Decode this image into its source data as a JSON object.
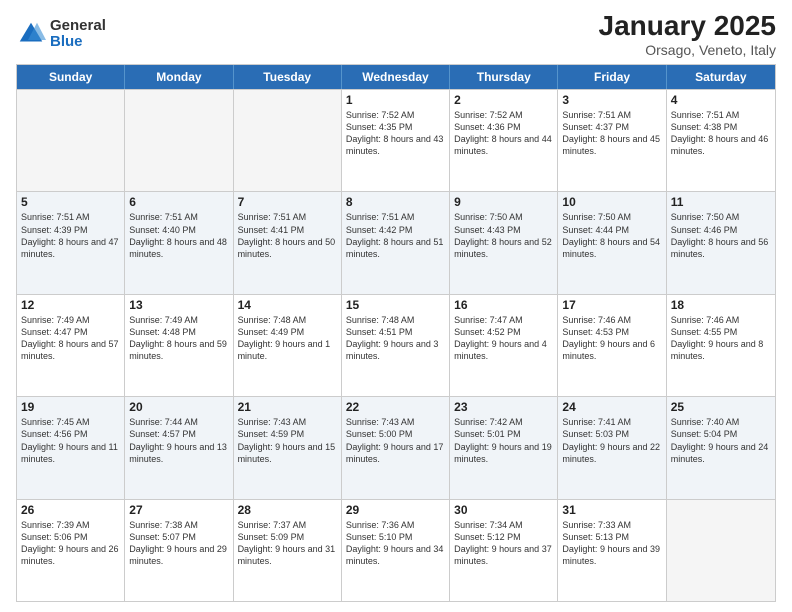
{
  "header": {
    "logo_general": "General",
    "logo_blue": "Blue",
    "main_title": "January 2025",
    "subtitle": "Orsago, Veneto, Italy"
  },
  "days_of_week": [
    "Sunday",
    "Monday",
    "Tuesday",
    "Wednesday",
    "Thursday",
    "Friday",
    "Saturday"
  ],
  "weeks": [
    [
      {
        "day": "",
        "text": ""
      },
      {
        "day": "",
        "text": ""
      },
      {
        "day": "",
        "text": ""
      },
      {
        "day": "1",
        "text": "Sunrise: 7:52 AM\nSunset: 4:35 PM\nDaylight: 8 hours\nand 43 minutes."
      },
      {
        "day": "2",
        "text": "Sunrise: 7:52 AM\nSunset: 4:36 PM\nDaylight: 8 hours\nand 44 minutes."
      },
      {
        "day": "3",
        "text": "Sunrise: 7:51 AM\nSunset: 4:37 PM\nDaylight: 8 hours\nand 45 minutes."
      },
      {
        "day": "4",
        "text": "Sunrise: 7:51 AM\nSunset: 4:38 PM\nDaylight: 8 hours\nand 46 minutes."
      }
    ],
    [
      {
        "day": "5",
        "text": "Sunrise: 7:51 AM\nSunset: 4:39 PM\nDaylight: 8 hours\nand 47 minutes."
      },
      {
        "day": "6",
        "text": "Sunrise: 7:51 AM\nSunset: 4:40 PM\nDaylight: 8 hours\nand 48 minutes."
      },
      {
        "day": "7",
        "text": "Sunrise: 7:51 AM\nSunset: 4:41 PM\nDaylight: 8 hours\nand 50 minutes."
      },
      {
        "day": "8",
        "text": "Sunrise: 7:51 AM\nSunset: 4:42 PM\nDaylight: 8 hours\nand 51 minutes."
      },
      {
        "day": "9",
        "text": "Sunrise: 7:50 AM\nSunset: 4:43 PM\nDaylight: 8 hours\nand 52 minutes."
      },
      {
        "day": "10",
        "text": "Sunrise: 7:50 AM\nSunset: 4:44 PM\nDaylight: 8 hours\nand 54 minutes."
      },
      {
        "day": "11",
        "text": "Sunrise: 7:50 AM\nSunset: 4:46 PM\nDaylight: 8 hours\nand 56 minutes."
      }
    ],
    [
      {
        "day": "12",
        "text": "Sunrise: 7:49 AM\nSunset: 4:47 PM\nDaylight: 8 hours\nand 57 minutes."
      },
      {
        "day": "13",
        "text": "Sunrise: 7:49 AM\nSunset: 4:48 PM\nDaylight: 8 hours\nand 59 minutes."
      },
      {
        "day": "14",
        "text": "Sunrise: 7:48 AM\nSunset: 4:49 PM\nDaylight: 9 hours\nand 1 minute."
      },
      {
        "day": "15",
        "text": "Sunrise: 7:48 AM\nSunset: 4:51 PM\nDaylight: 9 hours\nand 3 minutes."
      },
      {
        "day": "16",
        "text": "Sunrise: 7:47 AM\nSunset: 4:52 PM\nDaylight: 9 hours\nand 4 minutes."
      },
      {
        "day": "17",
        "text": "Sunrise: 7:46 AM\nSunset: 4:53 PM\nDaylight: 9 hours\nand 6 minutes."
      },
      {
        "day": "18",
        "text": "Sunrise: 7:46 AM\nSunset: 4:55 PM\nDaylight: 9 hours\nand 8 minutes."
      }
    ],
    [
      {
        "day": "19",
        "text": "Sunrise: 7:45 AM\nSunset: 4:56 PM\nDaylight: 9 hours\nand 11 minutes."
      },
      {
        "day": "20",
        "text": "Sunrise: 7:44 AM\nSunset: 4:57 PM\nDaylight: 9 hours\nand 13 minutes."
      },
      {
        "day": "21",
        "text": "Sunrise: 7:43 AM\nSunset: 4:59 PM\nDaylight: 9 hours\nand 15 minutes."
      },
      {
        "day": "22",
        "text": "Sunrise: 7:43 AM\nSunset: 5:00 PM\nDaylight: 9 hours\nand 17 minutes."
      },
      {
        "day": "23",
        "text": "Sunrise: 7:42 AM\nSunset: 5:01 PM\nDaylight: 9 hours\nand 19 minutes."
      },
      {
        "day": "24",
        "text": "Sunrise: 7:41 AM\nSunset: 5:03 PM\nDaylight: 9 hours\nand 22 minutes."
      },
      {
        "day": "25",
        "text": "Sunrise: 7:40 AM\nSunset: 5:04 PM\nDaylight: 9 hours\nand 24 minutes."
      }
    ],
    [
      {
        "day": "26",
        "text": "Sunrise: 7:39 AM\nSunset: 5:06 PM\nDaylight: 9 hours\nand 26 minutes."
      },
      {
        "day": "27",
        "text": "Sunrise: 7:38 AM\nSunset: 5:07 PM\nDaylight: 9 hours\nand 29 minutes."
      },
      {
        "day": "28",
        "text": "Sunrise: 7:37 AM\nSunset: 5:09 PM\nDaylight: 9 hours\nand 31 minutes."
      },
      {
        "day": "29",
        "text": "Sunrise: 7:36 AM\nSunset: 5:10 PM\nDaylight: 9 hours\nand 34 minutes."
      },
      {
        "day": "30",
        "text": "Sunrise: 7:34 AM\nSunset: 5:12 PM\nDaylight: 9 hours\nand 37 minutes."
      },
      {
        "day": "31",
        "text": "Sunrise: 7:33 AM\nSunset: 5:13 PM\nDaylight: 9 hours\nand 39 minutes."
      },
      {
        "day": "",
        "text": ""
      }
    ]
  ]
}
